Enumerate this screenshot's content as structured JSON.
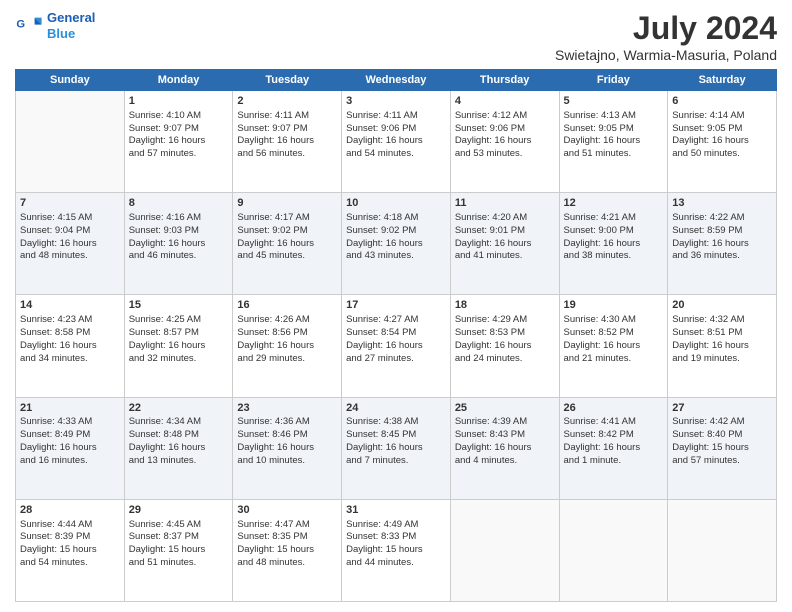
{
  "header": {
    "logo_line1": "General",
    "logo_line2": "Blue",
    "title": "July 2024",
    "subtitle": "Swietajno, Warmia-Masuria, Poland"
  },
  "days_of_week": [
    "Sunday",
    "Monday",
    "Tuesday",
    "Wednesday",
    "Thursday",
    "Friday",
    "Saturday"
  ],
  "weeks": [
    [
      {
        "day": "",
        "detail": ""
      },
      {
        "day": "1",
        "detail": "Sunrise: 4:10 AM\nSunset: 9:07 PM\nDaylight: 16 hours\nand 57 minutes."
      },
      {
        "day": "2",
        "detail": "Sunrise: 4:11 AM\nSunset: 9:07 PM\nDaylight: 16 hours\nand 56 minutes."
      },
      {
        "day": "3",
        "detail": "Sunrise: 4:11 AM\nSunset: 9:06 PM\nDaylight: 16 hours\nand 54 minutes."
      },
      {
        "day": "4",
        "detail": "Sunrise: 4:12 AM\nSunset: 9:06 PM\nDaylight: 16 hours\nand 53 minutes."
      },
      {
        "day": "5",
        "detail": "Sunrise: 4:13 AM\nSunset: 9:05 PM\nDaylight: 16 hours\nand 51 minutes."
      },
      {
        "day": "6",
        "detail": "Sunrise: 4:14 AM\nSunset: 9:05 PM\nDaylight: 16 hours\nand 50 minutes."
      }
    ],
    [
      {
        "day": "7",
        "detail": "Sunrise: 4:15 AM\nSunset: 9:04 PM\nDaylight: 16 hours\nand 48 minutes."
      },
      {
        "day": "8",
        "detail": "Sunrise: 4:16 AM\nSunset: 9:03 PM\nDaylight: 16 hours\nand 46 minutes."
      },
      {
        "day": "9",
        "detail": "Sunrise: 4:17 AM\nSunset: 9:02 PM\nDaylight: 16 hours\nand 45 minutes."
      },
      {
        "day": "10",
        "detail": "Sunrise: 4:18 AM\nSunset: 9:02 PM\nDaylight: 16 hours\nand 43 minutes."
      },
      {
        "day": "11",
        "detail": "Sunrise: 4:20 AM\nSunset: 9:01 PM\nDaylight: 16 hours\nand 41 minutes."
      },
      {
        "day": "12",
        "detail": "Sunrise: 4:21 AM\nSunset: 9:00 PM\nDaylight: 16 hours\nand 38 minutes."
      },
      {
        "day": "13",
        "detail": "Sunrise: 4:22 AM\nSunset: 8:59 PM\nDaylight: 16 hours\nand 36 minutes."
      }
    ],
    [
      {
        "day": "14",
        "detail": "Sunrise: 4:23 AM\nSunset: 8:58 PM\nDaylight: 16 hours\nand 34 minutes."
      },
      {
        "day": "15",
        "detail": "Sunrise: 4:25 AM\nSunset: 8:57 PM\nDaylight: 16 hours\nand 32 minutes."
      },
      {
        "day": "16",
        "detail": "Sunrise: 4:26 AM\nSunset: 8:56 PM\nDaylight: 16 hours\nand 29 minutes."
      },
      {
        "day": "17",
        "detail": "Sunrise: 4:27 AM\nSunset: 8:54 PM\nDaylight: 16 hours\nand 27 minutes."
      },
      {
        "day": "18",
        "detail": "Sunrise: 4:29 AM\nSunset: 8:53 PM\nDaylight: 16 hours\nand 24 minutes."
      },
      {
        "day": "19",
        "detail": "Sunrise: 4:30 AM\nSunset: 8:52 PM\nDaylight: 16 hours\nand 21 minutes."
      },
      {
        "day": "20",
        "detail": "Sunrise: 4:32 AM\nSunset: 8:51 PM\nDaylight: 16 hours\nand 19 minutes."
      }
    ],
    [
      {
        "day": "21",
        "detail": "Sunrise: 4:33 AM\nSunset: 8:49 PM\nDaylight: 16 hours\nand 16 minutes."
      },
      {
        "day": "22",
        "detail": "Sunrise: 4:34 AM\nSunset: 8:48 PM\nDaylight: 16 hours\nand 13 minutes."
      },
      {
        "day": "23",
        "detail": "Sunrise: 4:36 AM\nSunset: 8:46 PM\nDaylight: 16 hours\nand 10 minutes."
      },
      {
        "day": "24",
        "detail": "Sunrise: 4:38 AM\nSunset: 8:45 PM\nDaylight: 16 hours\nand 7 minutes."
      },
      {
        "day": "25",
        "detail": "Sunrise: 4:39 AM\nSunset: 8:43 PM\nDaylight: 16 hours\nand 4 minutes."
      },
      {
        "day": "26",
        "detail": "Sunrise: 4:41 AM\nSunset: 8:42 PM\nDaylight: 16 hours\nand 1 minute."
      },
      {
        "day": "27",
        "detail": "Sunrise: 4:42 AM\nSunset: 8:40 PM\nDaylight: 15 hours\nand 57 minutes."
      }
    ],
    [
      {
        "day": "28",
        "detail": "Sunrise: 4:44 AM\nSunset: 8:39 PM\nDaylight: 15 hours\nand 54 minutes."
      },
      {
        "day": "29",
        "detail": "Sunrise: 4:45 AM\nSunset: 8:37 PM\nDaylight: 15 hours\nand 51 minutes."
      },
      {
        "day": "30",
        "detail": "Sunrise: 4:47 AM\nSunset: 8:35 PM\nDaylight: 15 hours\nand 48 minutes."
      },
      {
        "day": "31",
        "detail": "Sunrise: 4:49 AM\nSunset: 8:33 PM\nDaylight: 15 hours\nand 44 minutes."
      },
      {
        "day": "",
        "detail": ""
      },
      {
        "day": "",
        "detail": ""
      },
      {
        "day": "",
        "detail": ""
      }
    ]
  ]
}
